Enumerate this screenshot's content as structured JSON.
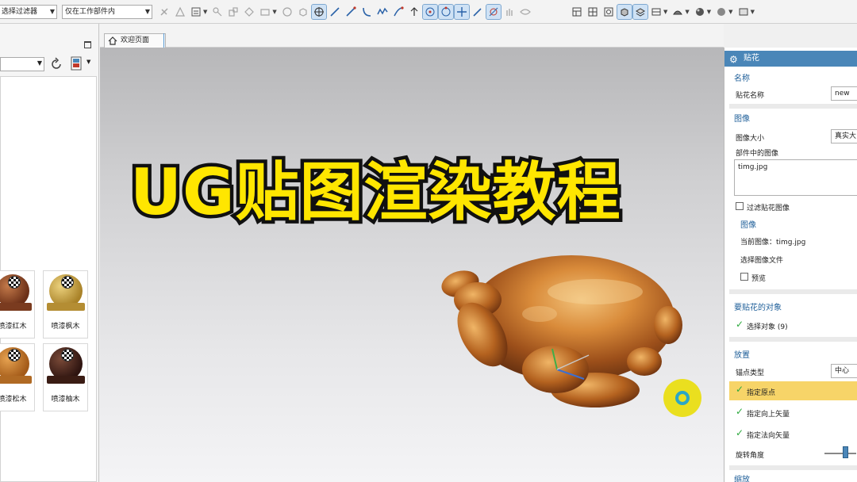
{
  "toolbar": {
    "filter_combo": "选择过滤器",
    "scope_combo": "仅在工作部件内",
    "icons": [
      "snap-icon",
      "point-icon",
      "line-icon",
      "arc-icon",
      "view-icon",
      "render-icon"
    ]
  },
  "left_panel": {
    "materials": [
      {
        "label": "喷漆红木"
      },
      {
        "label": "喷漆枫木"
      },
      {
        "label": "喷漆松木"
      },
      {
        "label": "喷漆柚木"
      }
    ]
  },
  "tabs": [
    {
      "label": "欢迎页面"
    }
  ],
  "viewport": {
    "overlay_title": "UG贴图渲染教程"
  },
  "decal_dialog": {
    "title": "贴花",
    "name_group": {
      "title": "名称",
      "label": "贴花名称",
      "value": "new"
    },
    "image_group": {
      "title": "图像",
      "size_label": "图像大小",
      "size_value": "真实大",
      "part_images_label": "部件中的图像",
      "list_item": "timg.jpg",
      "filter_label": "过滤贴花图像",
      "sub_title": "图像",
      "current_image": "当前图像：timg.jpg",
      "select_file": "选择图像文件",
      "preview_label": "预览"
    },
    "objects_group": {
      "title": "要贴花的对象",
      "select_objects": "选择对象 (9)"
    },
    "placement_group": {
      "title": "放置",
      "anchor_label": "锚点类型",
      "anchor_value": "中心",
      "origin": "指定原点",
      "up_vector": "指定向上矢量",
      "normal_vector": "指定法向矢量",
      "rotation_label": "旋转角度"
    },
    "scale_group": {
      "title": "缩放"
    }
  },
  "colors": {
    "accent": "#4a86b8",
    "highlight": "#f7d468",
    "title_yellow": "#ffe600",
    "check_green": "#2eaa3e"
  }
}
